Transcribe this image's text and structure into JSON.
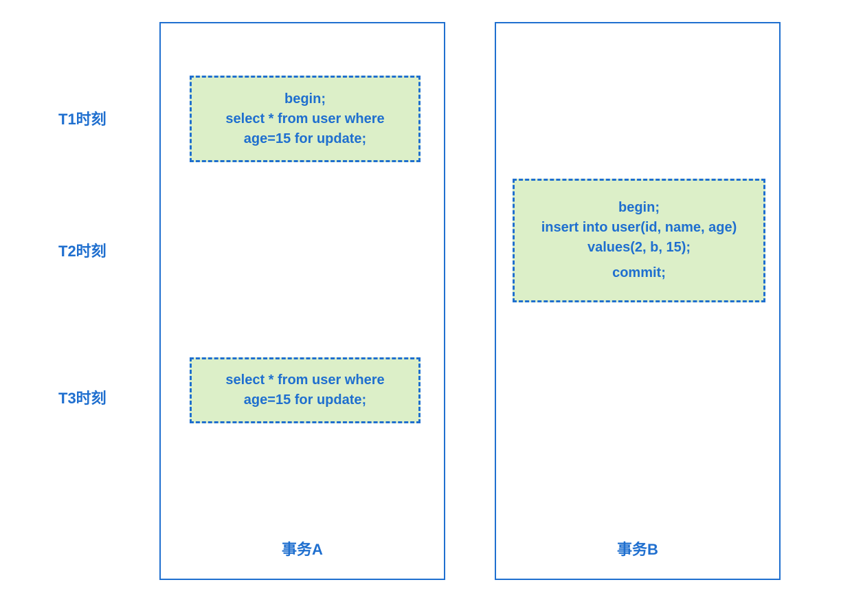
{
  "times": {
    "t1": "T1时刻",
    "t2": "T2时刻",
    "t3": "T3时刻"
  },
  "columns": {
    "a": {
      "title": "事务A"
    },
    "b": {
      "title": "事务B"
    }
  },
  "boxes": {
    "a_t1": {
      "l1": "begin;",
      "l2": "select * from user where",
      "l3": "age=15 for update;"
    },
    "b_t2": {
      "l1": "begin;",
      "l2": "insert into user(id, name, age)",
      "l3": "values(2, b, 15);",
      "l4": "commit;"
    },
    "a_t3": {
      "l1": "select * from user where",
      "l2": "age=15 for update;"
    }
  }
}
